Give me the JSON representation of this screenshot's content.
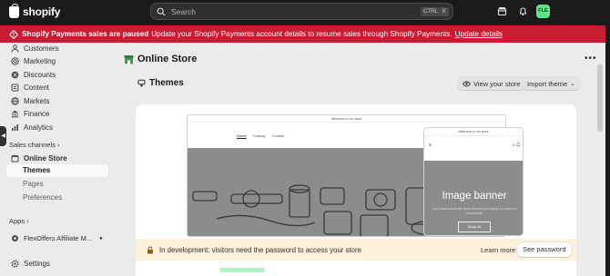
{
  "topbar": {
    "logo_text": "shopify",
    "search_placeholder": "Search",
    "kbd_ctrl": "CTRL",
    "kbd_k": "K",
    "avatar_initials": "FLE"
  },
  "banner": {
    "bold": "Shopify Payments sales are paused",
    "text": "Update your Shopify Payments account details to resume sales through Shopify Payments.",
    "link": "Update details",
    "color": "#c71c32"
  },
  "sidebar": {
    "items": [
      {
        "label": "Customers",
        "icon": "person-icon"
      },
      {
        "label": "Marketing",
        "icon": "target-icon"
      },
      {
        "label": "Discounts",
        "icon": "discount-icon"
      },
      {
        "label": "Content",
        "icon": "content-icon"
      },
      {
        "label": "Markets",
        "icon": "globe-icon"
      },
      {
        "label": "Finance",
        "icon": "bank-icon"
      },
      {
        "label": "Analytics",
        "icon": "chart-icon"
      }
    ],
    "sales_channels_label": "Sales channels",
    "channel": "Online Store",
    "sub_items": [
      "Themes",
      "Pages",
      "Preferences"
    ],
    "apps_label": "Apps",
    "app": "FlexOffers Affiliate M...",
    "settings": "Settings"
  },
  "main": {
    "title": "Online Store",
    "section_title": "Themes",
    "view_store": "View your store",
    "import_theme": "Import theme",
    "preview": {
      "desktop_header": "Welcome to our store",
      "desktop_nav": [
        "Home",
        "Catalog",
        "Contact"
      ],
      "mobile_header": "Welcome to our store",
      "mobile_banner_title": "Image banner",
      "mobile_banner_sub": "Give customers details about the banner image(s) or content on the template.",
      "mobile_banner_button": "Shop all"
    },
    "dev_notice": "In development: visitors need the password to access your store",
    "learn_more": "Learn more",
    "see_password": "See password"
  }
}
